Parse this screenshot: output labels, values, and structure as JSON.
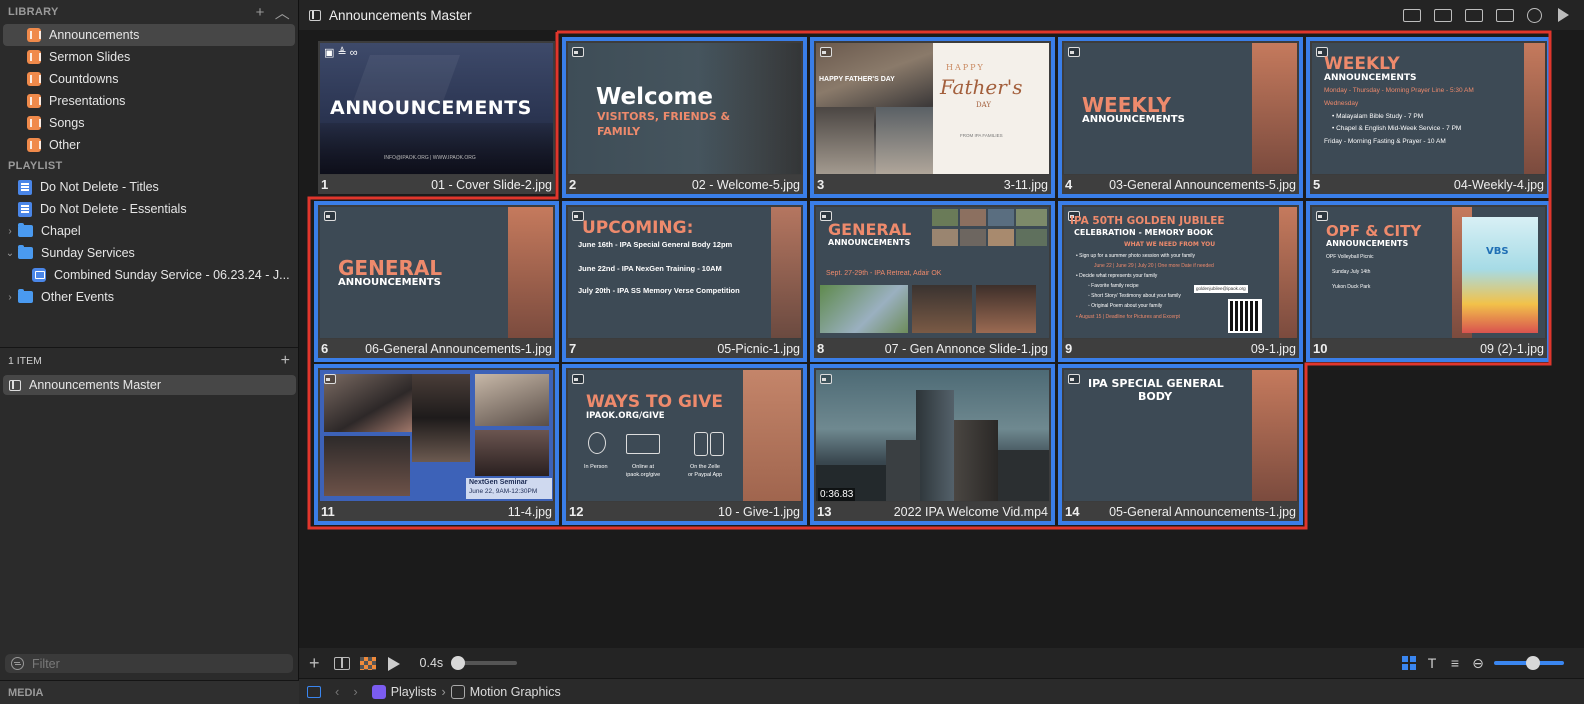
{
  "library": {
    "header": "LIBRARY",
    "items": [
      {
        "label": "Announcements",
        "selected": true
      },
      {
        "label": "Sermon Slides"
      },
      {
        "label": "Countdowns"
      },
      {
        "label": "Presentations"
      },
      {
        "label": "Songs"
      },
      {
        "label": "Other"
      }
    ]
  },
  "playlist": {
    "header": "PLAYLIST",
    "items": [
      {
        "label": "Do Not Delete - Titles",
        "icon": "document-icon"
      },
      {
        "label": "Do Not Delete - Essentials",
        "icon": "document-icon"
      },
      {
        "label": "Chapel",
        "icon": "folder-icon",
        "disclosure": "›"
      },
      {
        "label": "Sunday Services",
        "icon": "folder-icon",
        "disclosure": "⌄"
      },
      {
        "label": "Combined Sunday Service - 06.23.24 - J...",
        "icon": "presentation-icon"
      },
      {
        "label": "Other Events",
        "icon": "folder-icon",
        "disclosure": "›"
      }
    ]
  },
  "items_panel": {
    "count_label": "1 ITEM",
    "item_label": "Announcements Master"
  },
  "filter": {
    "placeholder": "Filter"
  },
  "media": {
    "header": "MEDIA"
  },
  "topbar": {
    "title": "Announcements Master"
  },
  "slides": [
    {
      "num": "1",
      "file": "01 - Cover Slide-2.jpg",
      "title": "ANNOUNCEMENTS",
      "footer": "INFO@IPAOK.ORG | WWW.IPAOK.ORG"
    },
    {
      "num": "2",
      "file": "02 - Welcome-5.jpg",
      "title": "Welcome",
      "subtitle": "VISITORS, FRIENDS &",
      "subtitle2": "FAMILY"
    },
    {
      "num": "3",
      "file": "3-11.jpg",
      "title": "HAPPY FATHER'S DAY",
      "script1": "HAPPY",
      "script2": "Father's",
      "script3": "DAY",
      "footer": "FROM IPA FAMILIES"
    },
    {
      "num": "4",
      "file": "03-General Announcements-5.jpg",
      "title": "WEEKLY",
      "subtitle": "ANNOUNCEMENTS"
    },
    {
      "num": "5",
      "file": "04-Weekly-4.jpg",
      "title": "WEEKLY",
      "subtitle": "ANNOUNCEMENTS",
      "lines": [
        "Monday - Thursday - Morning Prayer Line - 5:30 AM",
        "Wednesday",
        "• Malayalam Bible Study - 7 PM",
        "• Chapel & English Mid-Week Service - 7 PM",
        "Friday - Morning Fasting & Prayer - 10 AM"
      ]
    },
    {
      "num": "6",
      "file": "06-General Announcements-1.jpg",
      "title": "GENERAL",
      "subtitle": "ANNOUNCEMENTS"
    },
    {
      "num": "7",
      "file": "05-Picnic-1.jpg",
      "title": "UPCOMING:",
      "lines": [
        "June 16th - IPA Special General Body 12pm",
        "June 22nd - IPA NexGen Training - 10AM",
        "July 20th - IPA SS Memory Verse Competition"
      ]
    },
    {
      "num": "8",
      "file": "07 - Gen Annonce Slide-1.jpg",
      "title": "GENERAL",
      "subtitle": "ANNOUNCEMENTS",
      "line": "Sept. 27-29th - IPA Retreat, Adair OK"
    },
    {
      "num": "9",
      "file": "09-1.jpg",
      "title": "IPA 50TH GOLDEN JUBILEE",
      "subtitle": "CELEBRATION - MEMORY BOOK",
      "tag": "WHAT WE NEED FROM YOU",
      "lines": [
        "• Sign up for a summer photo session with your family",
        "June 22 | June 29 | July 20 | One more Date if needed",
        "• Decide what represents your family",
        "◦ Favorite family recipe",
        "◦ Short Story/ Testimony about your family",
        "◦ Original Poem about your family",
        "• August 15 | Deadline for Pictures and Excerpt"
      ],
      "email": "goldenjubilee@ipaok.org"
    },
    {
      "num": "10",
      "file": "09 (2)-1.jpg",
      "title": "OPF & CITY",
      "subtitle": "ANNOUNCEMENTS",
      "lines": [
        "OPF Volleyball Picnic",
        "Sunday July 14th",
        "Yukon Duck Park"
      ],
      "vbs": "VBS"
    },
    {
      "num": "11",
      "file": "11-4.jpg",
      "caption1": "NextGen Seminar",
      "caption2": "June 22, 9AM-12:30PM"
    },
    {
      "num": "12",
      "file": "10 - Give-1.jpg",
      "title": "WAYS TO GIVE",
      "subtitle": "IPAOK.ORG/GIVE",
      "opt1": "In Person",
      "opt2a": "Online at",
      "opt2b": "ipaok.org/give",
      "opt3a": "On the Zelle",
      "opt3b": "or Paypal App"
    },
    {
      "num": "13",
      "file": "2022 IPA Welcome Vid.mp4",
      "duration": "0:36.83"
    },
    {
      "num": "14",
      "file": "05-General Announcements-1.jpg",
      "title": "IPA SPECIAL GENERAL",
      "subtitle": "BODY"
    }
  ],
  "bottombar": {
    "duration": "0.4s",
    "duration_slider_fraction": 0.1,
    "zoom_slider_fraction": 0.55
  },
  "navbar": {
    "crumb1": "Playlists",
    "crumb2": "Motion Graphics",
    "sep": "›"
  },
  "colors": {
    "accent": "#3a7ee8",
    "orange": "#f08a4b",
    "selection_outline": "#e0362c"
  }
}
